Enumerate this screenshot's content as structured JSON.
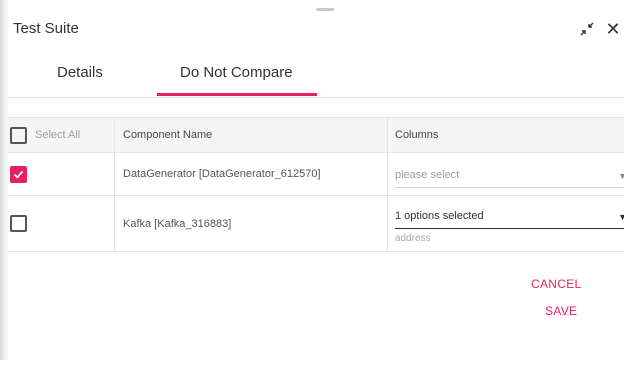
{
  "dialog": {
    "title": "Test Suite"
  },
  "window_controls": {
    "minimize_icon": "collapse-arrows",
    "close_icon": "close",
    "close_glyph": "✕"
  },
  "tabs": [
    {
      "label": "Details",
      "active": false
    },
    {
      "label": "Do Not Compare",
      "active": true
    }
  ],
  "accent_color": "#e91e63",
  "table": {
    "select_all_label": "Select All",
    "headers": {
      "component_name": "Component Name",
      "columns": "Columns"
    },
    "rows": [
      {
        "checked": true,
        "component_name": "DataGenerator [DataGenerator_612570]",
        "columns_value": "please select",
        "columns_placeholder": true,
        "hint": ""
      },
      {
        "checked": false,
        "component_name": "Kafka [Kafka_316883]",
        "columns_value": "1 options selected",
        "columns_placeholder": false,
        "hint": "address"
      }
    ]
  },
  "actions": {
    "cancel": "CANCEL",
    "save": "SAVE"
  }
}
